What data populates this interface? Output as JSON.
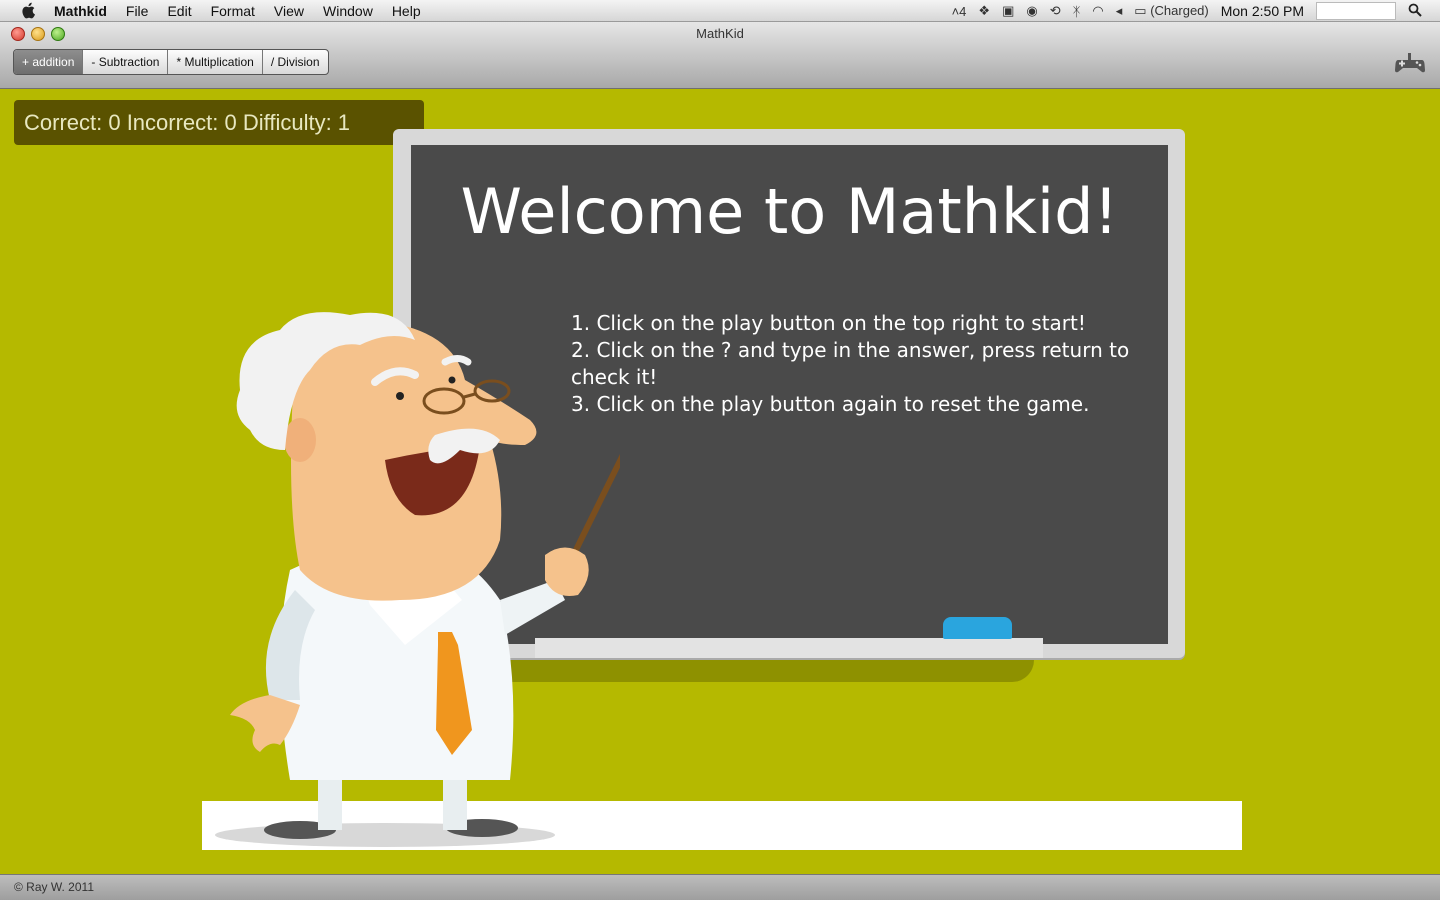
{
  "menubar": {
    "app_name": "Mathkid",
    "items": [
      "File",
      "Edit",
      "Format",
      "View",
      "Window",
      "Help"
    ],
    "status": {
      "adobe_count": "4",
      "battery": "(Charged)",
      "clock": "Mon 2:50 PM"
    }
  },
  "window": {
    "title": "MathKid",
    "toolbar": {
      "tabs": [
        "+ addition",
        "- Subtraction",
        "* Multiplication",
        "/ Division"
      ],
      "active_tab": "+ addition"
    }
  },
  "score": {
    "text": "Correct: 0 Incorrect: 0 Difficulty: 1"
  },
  "board": {
    "heading": "Welcome to Mathkid!",
    "steps": [
      "1. Click on the play button on the top right to start!",
      "2. Click on the ? and type in the answer, press return to check it!",
      "3. Click on the play button again to reset the game."
    ]
  },
  "footer": {
    "copyright": "© Ray W. 2011"
  },
  "colors": {
    "background": "#b5b900",
    "board": "#4a4a4a",
    "score_bar": "#5a5200",
    "eraser": "#2aa5de",
    "tie": "#f0961e"
  }
}
